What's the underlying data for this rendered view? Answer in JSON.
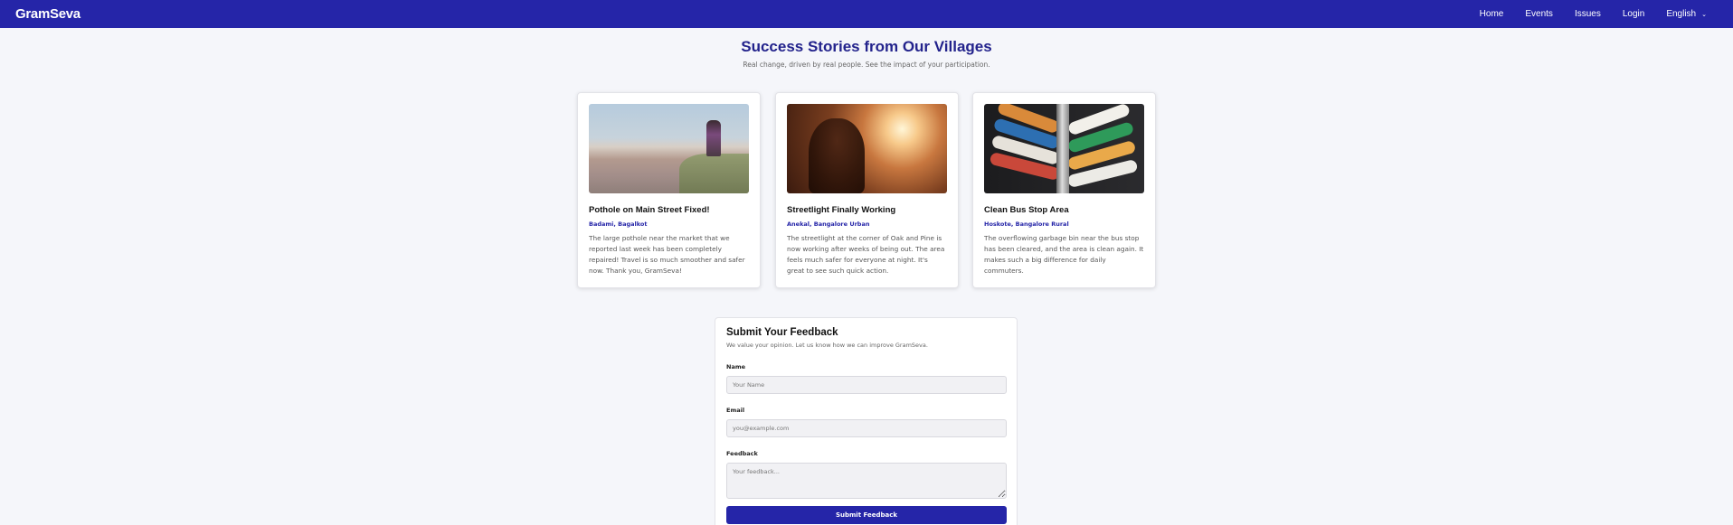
{
  "navbar": {
    "brand": "GramSeva",
    "links": [
      "Home",
      "Events",
      "Issues",
      "Login"
    ],
    "language": "English"
  },
  "header": {
    "title": "Success Stories from Our Villages",
    "subtitle": "Real change, driven by real people. See the impact of your participation."
  },
  "stories": [
    {
      "title": "Pothole on Main Street Fixed!",
      "location": "Badami, Bagalkot",
      "text": "The large pothole near the market that we reported last week has been completely repaired! Travel is so much smoother and safer now. Thank you, GramSeva!"
    },
    {
      "title": "Streetlight Finally Working",
      "location": "Anekal, Bangalore Urban",
      "text": "The streetlight at the corner of Oak and Pine is now working after weeks of being out. The area feels much safer for everyone at night. It's great to see such quick action."
    },
    {
      "title": "Clean Bus Stop Area",
      "location": "Hoskote, Bangalore Rural",
      "text": "The overflowing garbage bin near the bus stop has been cleared, and the area is clean again. It makes such a big difference for daily commuters."
    }
  ],
  "feedback": {
    "title": "Submit Your Feedback",
    "description": "We value your opinion. Let us know how we can improve GramSeva.",
    "name_label": "Name",
    "name_placeholder": "Your Name",
    "email_label": "Email",
    "email_placeholder": "you@example.com",
    "feedback_label": "Feedback",
    "feedback_placeholder": "Your feedback...",
    "submit_label": "Submit Feedback"
  },
  "colors": {
    "primary": "#2525a8",
    "title": "#23238c",
    "background": "#f5f6fa"
  }
}
